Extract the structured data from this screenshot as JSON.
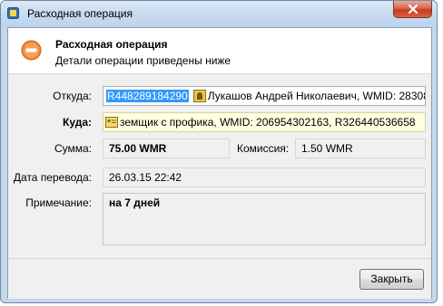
{
  "window": {
    "title": "Расходная операция",
    "close_icon": "close-icon"
  },
  "header": {
    "title": "Расходная операция",
    "subtitle": "Детали операции приведены ниже",
    "icon": "minus-circle-icon"
  },
  "from": {
    "label": "Откуда:",
    "purse": "R448289184290",
    "owner": "Лукашов Андрей Николаевич, WMID: 283083..."
  },
  "to": {
    "label": "Куда:",
    "value": "земщик с профика, WMID: 206954302163, R326440536658"
  },
  "amount": {
    "label": "Сумма:",
    "value": "75.00 WMR"
  },
  "fee": {
    "label": "Комиссия:",
    "value": "1.50 WMR"
  },
  "date": {
    "label": "Дата перевода:",
    "value": "26.03.15 22:42"
  },
  "note": {
    "label": "Примечание:",
    "value": "на 7 дней"
  },
  "buttons": {
    "close": "Закрыть"
  },
  "colors": {
    "selection": "#3399ff",
    "field_yellow": "#ffffe1",
    "titlebar": "#c5d9ee",
    "close_red": "#c63a1f"
  }
}
